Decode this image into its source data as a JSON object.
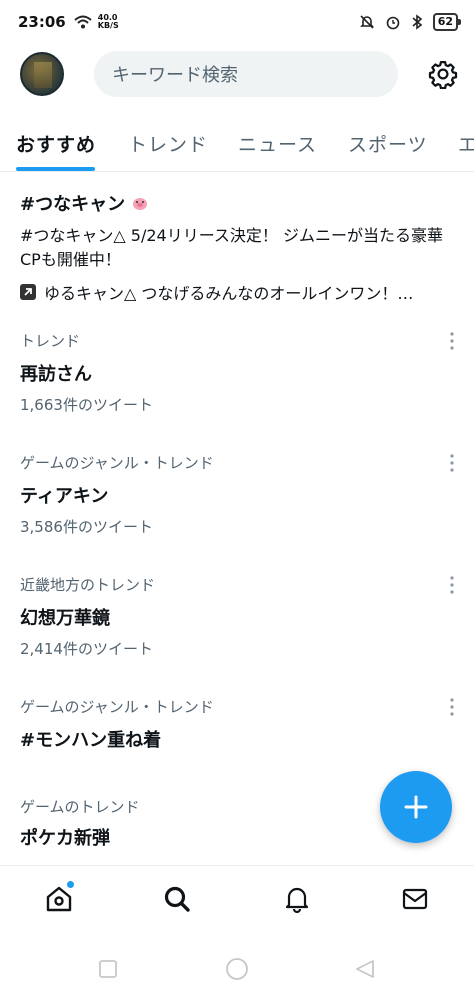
{
  "status": {
    "time": "23:06",
    "speed_value": "40.0",
    "speed_unit": "KB/S",
    "battery": "62"
  },
  "header": {
    "search_placeholder": "キーワード検索"
  },
  "tabs": [
    {
      "label": "おすすめ",
      "active": true
    },
    {
      "label": "トレンド",
      "active": false
    },
    {
      "label": "ニュース",
      "active": false
    },
    {
      "label": "スポーツ",
      "active": false
    },
    {
      "label": "エ",
      "active": false
    }
  ],
  "promo": {
    "title": "#つなキャン",
    "description": "#つなキャン△ 5/24リリース決定！ ジムニーが当たる豪華CPも開催中！",
    "link_text": "ゆるキャン△ つなげるみんなのオールインワン！…"
  },
  "trends": [
    {
      "category": "トレンド",
      "name": "再訪さん",
      "count": "1,663件のツイート"
    },
    {
      "category": "ゲームのジャンル・トレンド",
      "name": "ティアキン",
      "count": "3,586件のツイート"
    },
    {
      "category": "近畿地方のトレンド",
      "name": "幻想万華鏡",
      "count": "2,414件のツイート"
    },
    {
      "category": "ゲームのジャンル・トレンド",
      "name": "#モンハン重ね着",
      "count": ""
    },
    {
      "category": "ゲームのトレンド",
      "name": "ポケカ新弾",
      "count": ""
    }
  ],
  "colors": {
    "accent": "#1d9bf0",
    "muted_text": "#536471",
    "search_bg": "#eff3f4"
  },
  "icons": {
    "settings": "gear-icon",
    "compose": "plus-icon",
    "home": "home-icon",
    "search": "search-icon",
    "notifications": "bell-icon",
    "messages": "mail-icon"
  }
}
